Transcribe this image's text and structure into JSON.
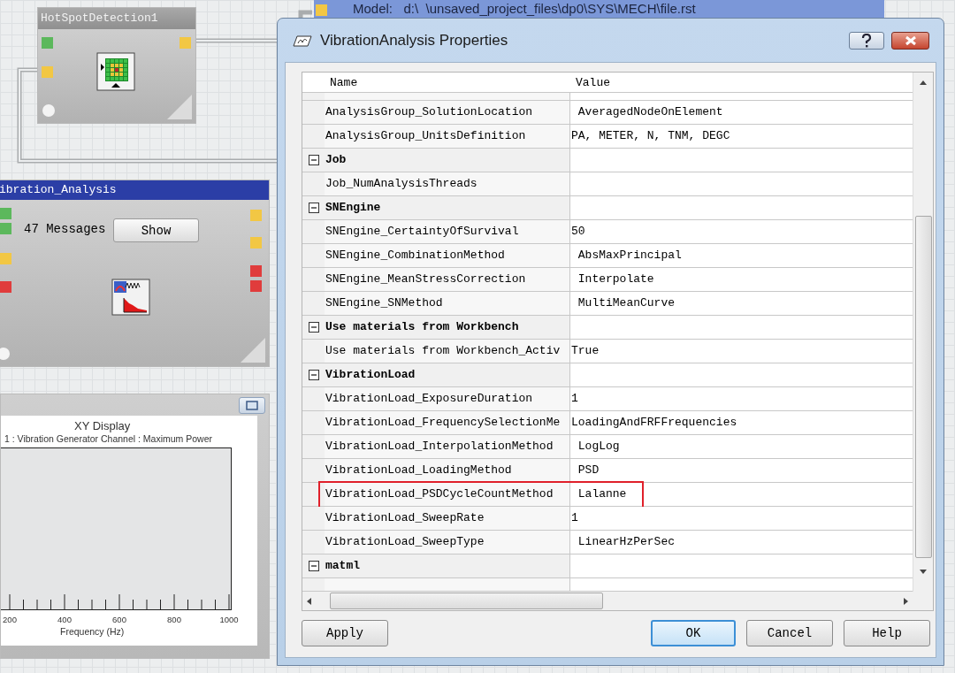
{
  "workspace": {
    "model_bar": "Model:   d:\\  \\unsaved_project_files\\dp0\\SYS\\MECH\\file.rst",
    "nodes": [
      {
        "kind": "hotspot",
        "title": "HotSpotDetection1",
        "ports_left": [
          {
            "color": "#5cb85c"
          },
          {
            "color": "#f2c744"
          }
        ],
        "ports_right": [
          {
            "color": "#f2c744"
          }
        ]
      },
      {
        "kind": "analysis",
        "title": "ibration_Analysis",
        "messages": "47 Messages",
        "button": "Show",
        "ports_left": [
          {
            "color": "#5cb85c"
          },
          {
            "color": "#5cb85c"
          },
          {
            "color": "#f2c744"
          },
          {
            "color": "#e03c3c"
          }
        ],
        "ports_right": [
          {
            "color": "#f2c744"
          },
          {
            "color": "#f2c744"
          },
          {
            "color": "#e03c3c"
          },
          {
            "color": "#e03c3c"
          }
        ]
      }
    ],
    "xy_display": {
      "title": "XY Display",
      "subtitle": "1 : Vibration Generator Channel : Maximum Power",
      "x_tick_labels": [
        "200",
        "400",
        "600",
        "800",
        "1000"
      ],
      "xlabel": "Frequency (Hz)"
    }
  },
  "dialog": {
    "title": "VibrationAnalysis Properties",
    "columns": [
      "Name",
      "Value"
    ],
    "rows": [
      {
        "kind": "property",
        "name": "AnalysisGroup_SolutionLocation",
        "value": " AveragedNodeOnElement",
        "highlighted": false
      },
      {
        "kind": "property",
        "name": "AnalysisGroup_UnitsDefinition",
        "value": "PA, METER, N, TNM, DEGC",
        "highlighted": false
      },
      {
        "kind": "group",
        "name": "Job",
        "expanded": true
      },
      {
        "kind": "property",
        "name": "Job_NumAnalysisThreads",
        "highlighted": false
      },
      {
        "kind": "group",
        "name": "SNEngine",
        "expanded": true
      },
      {
        "kind": "property",
        "name": "SNEngine_CertaintyOfSurvival",
        "value": "50",
        "highlighted": false
      },
      {
        "kind": "property",
        "name": "SNEngine_CombinationMethod",
        "value": " AbsMaxPrincipal",
        "highlighted": false
      },
      {
        "kind": "property",
        "name": "SNEngine_MeanStressCorrection",
        "value": " Interpolate",
        "highlighted": false
      },
      {
        "kind": "property",
        "name": "SNEngine_SNMethod",
        "value": " MultiMeanCurve",
        "highlighted": false
      },
      {
        "kind": "group",
        "name": "Use materials from Workbench",
        "expanded": true
      },
      {
        "kind": "property",
        "name": "Use materials from Workbench_Activ",
        "value": "True",
        "highlighted": false
      },
      {
        "kind": "group",
        "name": "VibrationLoad",
        "expanded": true
      },
      {
        "kind": "property",
        "name": "VibrationLoad_ExposureDuration",
        "value": "1",
        "highlighted": false
      },
      {
        "kind": "property",
        "name": "VibrationLoad_FrequencySelectionMe",
        "value": "LoadingAndFRFFrequencies",
        "highlighted": false
      },
      {
        "kind": "property",
        "name": "VibrationLoad_InterpolationMethod",
        "value": " LogLog",
        "highlighted": false
      },
      {
        "kind": "property",
        "name": "VibrationLoad_LoadingMethod",
        "value": " PSD",
        "highlighted": false
      },
      {
        "kind": "property",
        "name": "VibrationLoad_PSDCycleCountMethod",
        "value": " Lalanne",
        "highlighted": true
      },
      {
        "kind": "property",
        "name": "VibrationLoad_SweepRate",
        "value": "1",
        "highlighted": false
      },
      {
        "kind": "property",
        "name": "VibrationLoad_SweepType",
        "value": " LinearHzPerSec",
        "highlighted": false
      },
      {
        "kind": "group",
        "name": "matml",
        "expanded": true
      }
    ],
    "buttons": [
      {
        "label": "Apply",
        "default": false
      },
      {
        "label": "OK",
        "default": true
      },
      {
        "label": "Cancel",
        "default": false
      },
      {
        "label": "Help",
        "default": false
      }
    ]
  }
}
